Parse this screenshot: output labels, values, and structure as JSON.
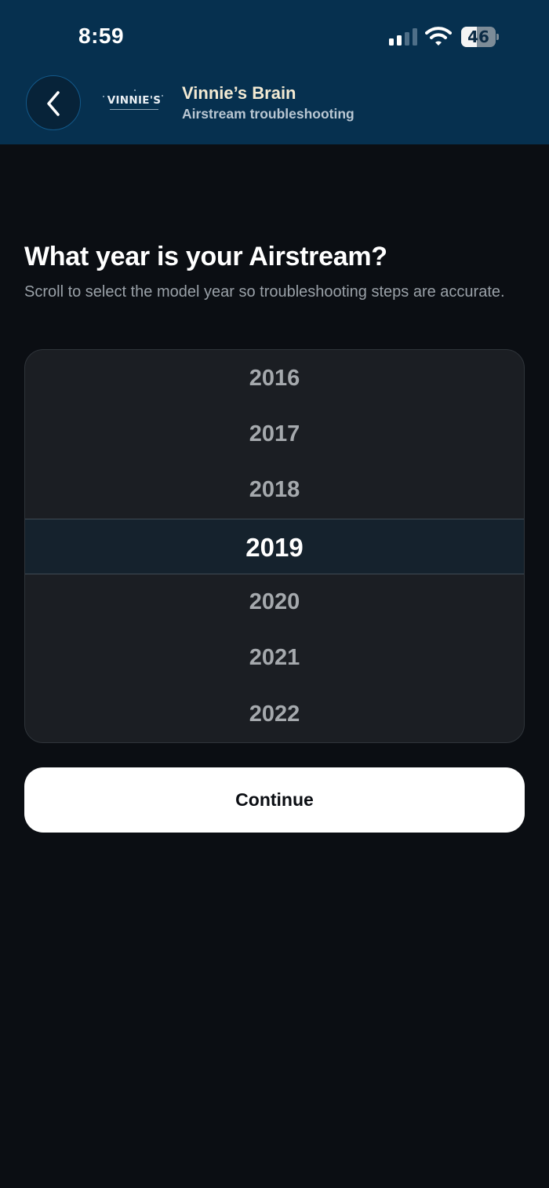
{
  "status_bar": {
    "time": "8:59",
    "battery_level": "46",
    "signal_bars_active": 2,
    "signal_bars_total": 4,
    "battery_fraction": 0.46
  },
  "header": {
    "logo_text": "VINNIE'S",
    "title": "Vinnie’s Brain",
    "subtitle": "Airstream troubleshooting",
    "back_icon": "chevron-left-icon"
  },
  "main": {
    "question": "What year is your Airstream?",
    "helper": "Scroll to select the model year so troubleshooting steps are accurate.",
    "picker": {
      "years": [
        "2016",
        "2017",
        "2018",
        "2019",
        "2020",
        "2021",
        "2022"
      ],
      "selected": "2019"
    },
    "continue_label": "Continue"
  },
  "colors": {
    "header_bg": "#06304f",
    "page_bg": "#0b0e13",
    "picker_bg": "#1b1e23",
    "selected_row_bg": "#15222d",
    "button_bg": "#ffffff",
    "title_color": "#f3ead3"
  }
}
